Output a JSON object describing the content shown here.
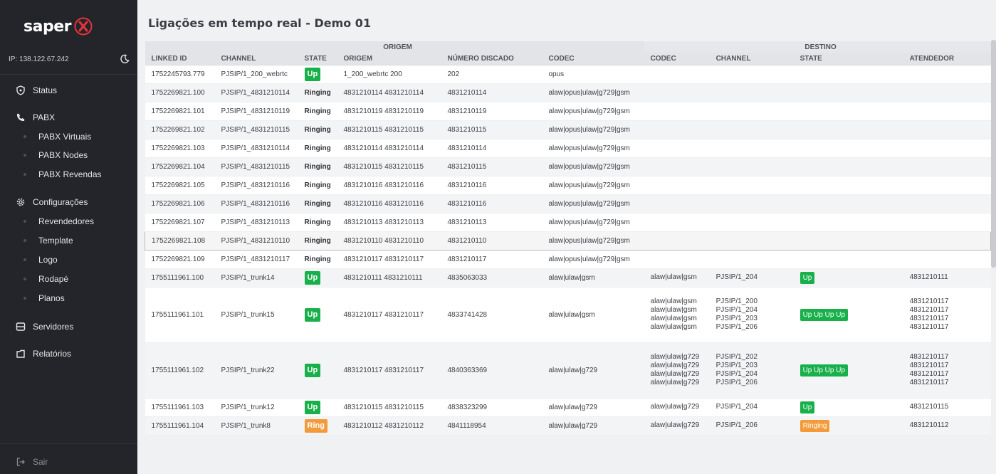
{
  "sidebar": {
    "logo_text": "saper",
    "ip": "IP: 138.122.67.242",
    "items": {
      "status": "Status",
      "pabx": "PABX",
      "pabx_virtuais": "PABX Virtuais",
      "pabx_nodes": "PABX Nodes",
      "pabx_revendas": "PABX Revendas",
      "configuracoes": "Configurações",
      "revendedores": "Revendedores",
      "template": "Template",
      "logo": "Logo",
      "rodape": "Rodapé",
      "planos": "Planos",
      "servidores": "Servidores",
      "relatorios": "Relatórios",
      "sair": "Sair"
    }
  },
  "page": {
    "title": "Ligações em tempo real - Demo 01"
  },
  "table": {
    "group_origem": "ORIGEM",
    "group_destino": "DESTINO",
    "headers": [
      "LINKED ID",
      "CHANNEL",
      "STATE",
      "ORIGEM",
      "NÚMERO DISCADO",
      "CODEC",
      "CODEC",
      "CHANNEL",
      "STATE",
      "ATENDEDOR"
    ],
    "rows": [
      {
        "linked_id": "1752245793.779",
        "channel": "PJSIP/1_200_webrtc",
        "state": "Up",
        "origem": "1_200_webrtc 200",
        "numero": "202",
        "codec": "opus"
      },
      {
        "linked_id": "1752269821.100",
        "channel": "PJSIP/1_4831210114",
        "state": "Ringing",
        "origem": "4831210114 4831210114",
        "numero": "4831210114",
        "codec": "alaw|opus|ulaw|g729|gsm"
      },
      {
        "linked_id": "1752269821.101",
        "channel": "PJSIP/1_4831210119",
        "state": "Ringing",
        "origem": "4831210119 4831210119",
        "numero": "4831210119",
        "codec": "alaw|opus|ulaw|g729|gsm"
      },
      {
        "linked_id": "1752269821.102",
        "channel": "PJSIP/1_4831210115",
        "state": "Ringing",
        "origem": "4831210115 4831210115",
        "numero": "4831210115",
        "codec": "alaw|opus|ulaw|g729|gsm"
      },
      {
        "linked_id": "1752269821.103",
        "channel": "PJSIP/1_4831210114",
        "state": "Ringing",
        "origem": "4831210114 4831210114",
        "numero": "4831210114",
        "codec": "alaw|opus|ulaw|g729|gsm"
      },
      {
        "linked_id": "1752269821.104",
        "channel": "PJSIP/1_4831210115",
        "state": "Ringing",
        "origem": "4831210115 4831210115",
        "numero": "4831210115",
        "codec": "alaw|opus|ulaw|g729|gsm"
      },
      {
        "linked_id": "1752269821.105",
        "channel": "PJSIP/1_4831210116",
        "state": "Ringing",
        "origem": "4831210116 4831210116",
        "numero": "4831210116",
        "codec": "alaw|opus|ulaw|g729|gsm"
      },
      {
        "linked_id": "1752269821.106",
        "channel": "PJSIP/1_4831210116",
        "state": "Ringing",
        "origem": "4831210116 4831210116",
        "numero": "4831210116",
        "codec": "alaw|opus|ulaw|g729|gsm"
      },
      {
        "linked_id": "1752269821.107",
        "channel": "PJSIP/1_4831210113",
        "state": "Ringing",
        "origem": "4831210113 4831210113",
        "numero": "4831210113",
        "codec": "alaw|opus|ulaw|g729|gsm"
      },
      {
        "linked_id": "1752269821.108",
        "channel": "PJSIP/1_4831210110",
        "state": "Ringing",
        "origem": "4831210110 4831210110",
        "numero": "4831210110",
        "codec": "alaw|opus|ulaw|g729|gsm"
      },
      {
        "linked_id": "1752269821.109",
        "channel": "PJSIP/1_4831210117",
        "state": "Ringing",
        "origem": "4831210117 4831210117",
        "numero": "4831210117",
        "codec": "alaw|opus|ulaw|g729|gsm"
      },
      {
        "linked_id": "1755111961.100",
        "channel": "PJSIP/1_trunk14",
        "state": "Up",
        "origem": "4831210111 4831210111",
        "numero": "4835063033",
        "codec": "alaw|ulaw|gsm",
        "d_codec": [
          "alaw|ulaw|gsm"
        ],
        "d_channel": [
          "PJSIP/1_204"
        ],
        "d_state": "Up",
        "d_state_color": "green",
        "atendedor": [
          "4831210111"
        ]
      },
      {
        "linked_id": "1755111961.101",
        "channel": "PJSIP/1_trunk15",
        "state": "Up",
        "origem": "4831210117 4831210117",
        "numero": "4833741428",
        "codec": "alaw|ulaw|gsm",
        "d_codec": [
          "alaw|ulaw|gsm",
          "alaw|ulaw|gsm",
          "alaw|ulaw|gsm",
          "alaw|ulaw|gsm"
        ],
        "d_channel": [
          "PJSIP/1_200",
          "PJSIP/1_204",
          "PJSIP/1_203",
          "PJSIP/1_206"
        ],
        "d_state": "Up Up Up Up",
        "d_state_color": "green",
        "atendedor": [
          "4831210117",
          "4831210117",
          "4831210117",
          "4831210117"
        ]
      },
      {
        "linked_id": "1755111961.102",
        "channel": "PJSIP/1_trunk22",
        "state": "Up",
        "origem": "4831210117 4831210117",
        "numero": "4840363369",
        "codec": "alaw|ulaw|g729",
        "d_codec": [
          "alaw|ulaw|g729",
          "alaw|ulaw|g729",
          "alaw|ulaw|g729",
          "alaw|ulaw|g729"
        ],
        "d_channel": [
          "PJSIP/1_202",
          "PJSIP/1_203",
          "PJSIP/1_204",
          "PJSIP/1_206"
        ],
        "d_state": "Up Up Up Up",
        "d_state_color": "green",
        "atendedor": [
          "4831210117",
          "4831210117",
          "4831210117",
          "4831210117"
        ]
      },
      {
        "linked_id": "1755111961.103",
        "channel": "PJSIP/1_trunk12",
        "state": "Up",
        "origem": "4831210115 4831210115",
        "numero": "4838323299",
        "codec": "alaw|ulaw|g729",
        "d_codec": [
          "alaw|ulaw|g729"
        ],
        "d_channel": [
          "PJSIP/1_204"
        ],
        "d_state": "Up",
        "d_state_color": "green",
        "atendedor": [
          "4831210115"
        ]
      },
      {
        "linked_id": "1755111961.104",
        "channel": "PJSIP/1_trunk8",
        "state": "Ring",
        "origem": "4831210112 4831210112",
        "numero": "4841118954",
        "codec": "alaw|ulaw|g729",
        "d_codec": [
          "alaw|ulaw|g729"
        ],
        "d_channel": [
          "PJSIP/1_206"
        ],
        "d_state": "Ringing",
        "d_state_color": "orange",
        "atendedor": [
          "4831210112"
        ]
      }
    ]
  },
  "colors": {
    "sidebar_bg": "#23252a",
    "badge_green": "#18b04a",
    "badge_orange": "#f39a3a",
    "logo_accent": "#e8323c"
  }
}
